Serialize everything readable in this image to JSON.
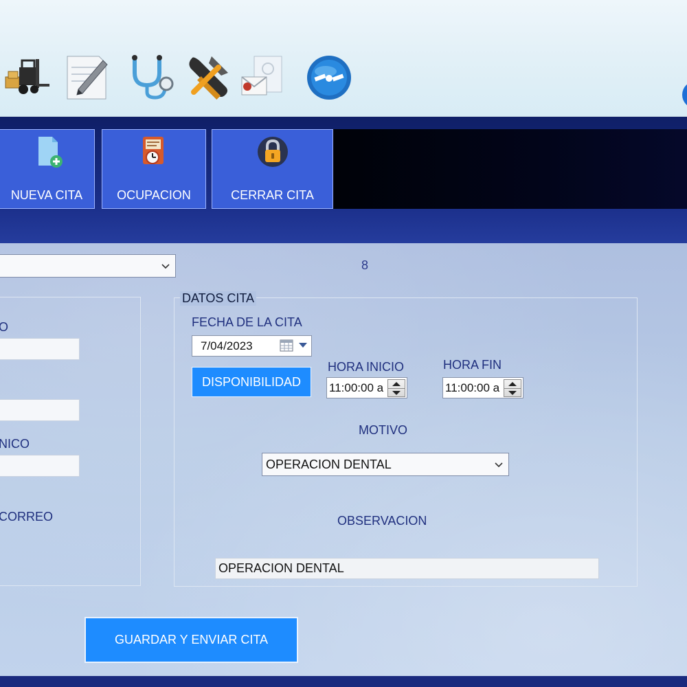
{
  "toolbar": {
    "icons": [
      {
        "name": "forklift-icon"
      },
      {
        "name": "edit-document-icon"
      },
      {
        "name": "stethoscope-icon"
      },
      {
        "name": "tools-icon"
      },
      {
        "name": "mail-icon"
      },
      {
        "name": "satellite-icon"
      }
    ]
  },
  "nav": {
    "nueva_cita": "NUEVA CITA",
    "ocupacion": "OCUPACION",
    "cerrar_cita": "CERRAR CITA"
  },
  "main": {
    "top_combo_value": "",
    "count_value": "8",
    "left_group": {
      "label1": "O",
      "label1_value": "",
      "label2_value": "",
      "label3": "NICO",
      "label3_value": "",
      "label4": "CORREO"
    },
    "datos_cita": {
      "title": "DATOS CITA",
      "fecha_label": "FECHA DE LA CITA",
      "fecha_value": "7/04/2023",
      "disponibilidad_button": "DISPONIBILIDAD",
      "hora_inicio_label": "HORA INICIO",
      "hora_inicio_value": "11:00:00 a",
      "hora_fin_label": "HORA FIN",
      "hora_fin_value": "11:00:00 a",
      "motivo_label": "MOTIVO",
      "motivo_value": "OPERACION DENTAL",
      "observacion_label": "OBSERVACION",
      "observacion_value": "OPERACION DENTAL"
    },
    "guardar_button": "GUARDAR Y ENVIAR CITA"
  },
  "colors": {
    "navy": "#142778",
    "button_blue": "#3a5fd9",
    "action_blue": "#1e8cff",
    "label_blue": "#1f2f7e"
  }
}
